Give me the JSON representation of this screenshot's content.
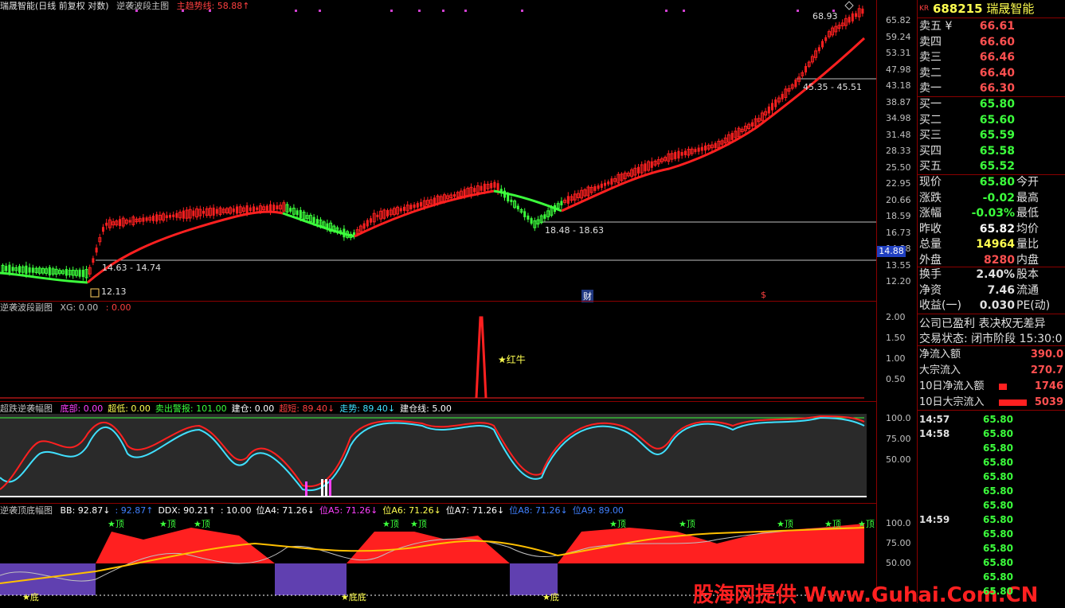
{
  "main_header": {
    "title": "瑞晟智能(日线 前复权 对数)",
    "indicator": "逆袭波段主图",
    "trend_label": "主趋势线: 58.88↑"
  },
  "main_price_axis": [
    "65.82",
    "59.24",
    "53.31",
    "47.98",
    "43.18",
    "38.87",
    "34.98",
    "31.48",
    "28.33",
    "25.50",
    "22.95",
    "20.66",
    "18.59",
    "16.73",
    "14.88",
    "13.55",
    "12.20"
  ],
  "main_annotations": {
    "high_label": "68.93",
    "range_top": "45.35 - 45.51",
    "range_mid": "18.48 - 18.63",
    "range_low": "14.63 - 14.74",
    "low_label": "12.13",
    "cai_label": "财",
    "dollar_label": "$",
    "current_price_tag": "14.88"
  },
  "pane2": {
    "title": "逆袭波段副图",
    "xg": "XG: 0.00",
    "xg2": ": 0.00",
    "axis": [
      "2.00",
      "1.50",
      "1.00",
      "0.50"
    ],
    "signal": "★红牛"
  },
  "pane3": {
    "title": "超跌逆袭幅图",
    "items": [
      {
        "label": "底部: 0.00",
        "color": "#ff40ff"
      },
      {
        "label": "超低: 0.00",
        "color": "#ffff50"
      },
      {
        "label": "卖出警报: 101.00",
        "color": "#3cff3c"
      },
      {
        "label": "建仓: 0.00",
        "color": "#ffffff"
      },
      {
        "label": "超短: 89.40↓",
        "color": "#ff4040"
      },
      {
        "label": "走势: 89.40↓",
        "color": "#40e0ff"
      },
      {
        "label": "建仓线: 5.00",
        "color": "#ffffff"
      }
    ],
    "axis": [
      "100.0",
      "75.00",
      "50.00"
    ]
  },
  "pane4": {
    "title": "逆袭顶底幅图",
    "items": [
      {
        "label": "BB: 92.87↓",
        "color": "#ffffff"
      },
      {
        "label": ": 92.87↑",
        "color": "#4080ff"
      },
      {
        "label": "DDX: 90.21↑",
        "color": "#ffffff"
      },
      {
        "label": ": 10.00",
        "color": "#ffffff"
      },
      {
        "label": "位A4: 71.26↓",
        "color": "#ffffff"
      },
      {
        "label": "位A5: 71.26↓",
        "color": "#ff40ff"
      },
      {
        "label": "位A6: 71.26↓",
        "color": "#ffff50"
      },
      {
        "label": "位A7: 71.26↓",
        "color": "#ffffff"
      },
      {
        "label": "位A8: 71.26↓",
        "color": "#4080ff"
      },
      {
        "label": "位A9: 89.00",
        "color": "#4080ff"
      }
    ],
    "axis": [
      "100.0",
      "75.00",
      "50.00"
    ],
    "top_marks": [
      "★顶",
      "★顶",
      "★顶",
      "★顶",
      "★顶",
      "★顶",
      "★顶",
      "★顶",
      "★顶",
      "★顶"
    ],
    "bottom_marks": [
      "★底",
      "★底底",
      "★底"
    ]
  },
  "quote": {
    "code": "688215",
    "name": "瑞晟智能",
    "kr": "KR",
    "asks": [
      {
        "label": "卖五 ¥",
        "price": "66.61"
      },
      {
        "label": "卖四",
        "price": "66.60"
      },
      {
        "label": "卖三",
        "price": "66.46"
      },
      {
        "label": "卖二",
        "price": "66.40"
      },
      {
        "label": "卖一",
        "price": "66.30"
      }
    ],
    "bids": [
      {
        "label": "买一",
        "price": "65.80"
      },
      {
        "label": "买二",
        "price": "65.60"
      },
      {
        "label": "买三",
        "price": "65.59"
      },
      {
        "label": "买四",
        "price": "65.58"
      },
      {
        "label": "买五",
        "price": "65.52"
      }
    ],
    "stats": [
      {
        "label": "现价",
        "value": "65.80",
        "color": "#3cff3c",
        "label2": "今开"
      },
      {
        "label": "涨跌",
        "value": "-0.02",
        "color": "#3cff3c",
        "label2": "最高"
      },
      {
        "label": "涨幅",
        "value": "-0.03%",
        "color": "#3cff3c",
        "label2": "最低"
      },
      {
        "label": "昨收",
        "value": "65.82",
        "color": "#ffffff",
        "label2": "均价"
      },
      {
        "label": "总量",
        "value": "14964",
        "color": "#ffff50",
        "label2": "量比"
      },
      {
        "label": "外盘",
        "value": "8280",
        "color": "#ff5050",
        "label2": "内盘"
      }
    ],
    "stats2": [
      {
        "label": "换手",
        "value": "2.40%",
        "color": "#e0e0e0",
        "label2": "股本"
      },
      {
        "label": "净资",
        "value": "7.46",
        "color": "#e0e0e0",
        "label2": "流通"
      },
      {
        "label": "收益(一)",
        "value": "0.030",
        "color": "#e0e0e0",
        "label2": "PE(动)"
      }
    ],
    "company_note": "公司已盈利 表决权无差异",
    "trade_status": "交易状态: 闭市阶段 15:30:0",
    "flows": [
      {
        "label": "净流入额",
        "value": "390.0"
      },
      {
        "label": "大宗流入",
        "value": "270.7"
      },
      {
        "label": "10日净流入额",
        "value": "1746"
      },
      {
        "label": "10日大宗流入",
        "value": "5039"
      }
    ],
    "ticks": [
      {
        "time": "14:57",
        "price": "65.80"
      },
      {
        "time": "14:58",
        "price": "65.80"
      },
      {
        "time": "",
        "price": "65.80"
      },
      {
        "time": "",
        "price": "65.80"
      },
      {
        "time": "",
        "price": "65.80"
      },
      {
        "time": "",
        "price": "65.80"
      },
      {
        "time": "",
        "price": "65.80"
      },
      {
        "time": "14:59",
        "price": "65.80"
      },
      {
        "time": "",
        "price": "65.80"
      },
      {
        "time": "",
        "price": "65.80"
      },
      {
        "time": "",
        "price": "65.80"
      },
      {
        "time": "",
        "price": "65.80"
      },
      {
        "time": "",
        "price": "65.80"
      }
    ]
  },
  "watermark": "股海网提供 Www.Guhai.Com.CN"
}
